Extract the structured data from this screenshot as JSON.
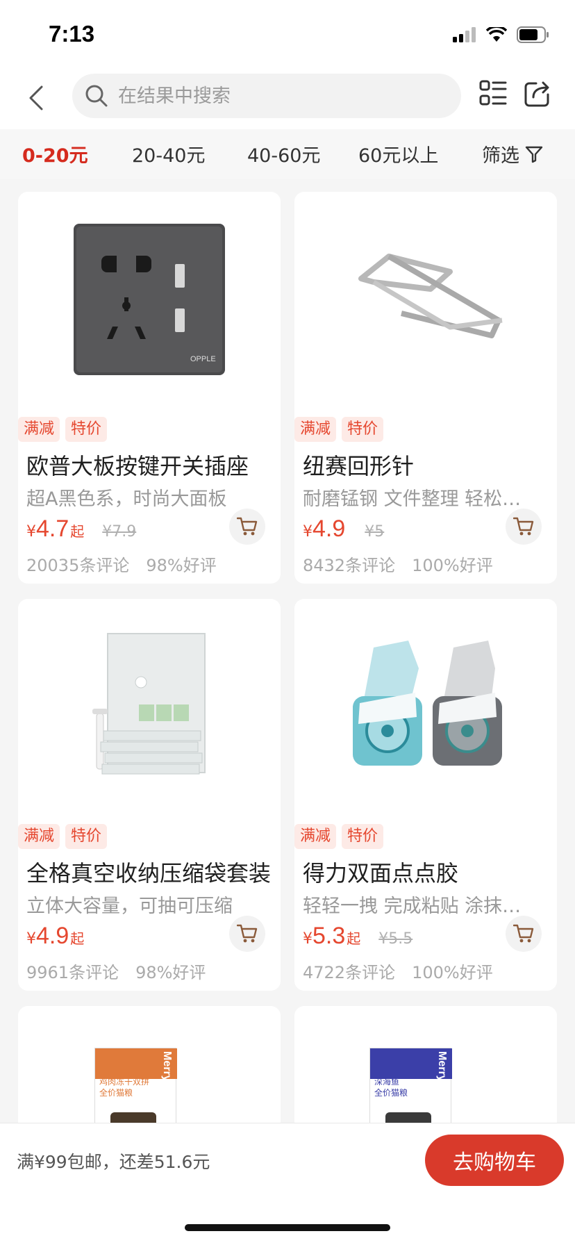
{
  "status": {
    "time": "7:13"
  },
  "search": {
    "placeholder": "在结果中搜索"
  },
  "filters": [
    {
      "label": "0-20元",
      "active": true
    },
    {
      "label": "20-40元"
    },
    {
      "label": "40-60元"
    },
    {
      "label": "60元以上"
    },
    {
      "label": "筛选"
    }
  ],
  "products": [
    {
      "tags": [
        "满减",
        "特价"
      ],
      "title": "欧普大板按键开关插座",
      "subtitle": "超A黑色系，时尚大面板",
      "currency": "¥",
      "price": "4.7",
      "price_suffix": "起",
      "orig_price": "¥7.9",
      "reviews": "20035条评论",
      "rating": "98%好评"
    },
    {
      "tags": [
        "满减",
        "特价"
      ],
      "title": "纽赛回形针",
      "subtitle": "耐磨锰钢 文件整理 轻松固定",
      "currency": "¥",
      "price": "4.9",
      "price_suffix": "",
      "orig_price": "¥5",
      "reviews": "8432条评论",
      "rating": "100%好评"
    },
    {
      "tags": [
        "满减",
        "特价"
      ],
      "title": "全格真空收纳压缩袋套装",
      "subtitle": "立体大容量，可抽可压缩",
      "currency": "¥",
      "price": "4.9",
      "price_suffix": "起",
      "orig_price": "",
      "reviews": "9961条评论",
      "rating": "98%好评"
    },
    {
      "tags": [
        "满减",
        "特价"
      ],
      "title": "得力双面点点胶",
      "subtitle": "轻轻一拽 完成粘贴 涂抹均匀",
      "currency": "¥",
      "price": "5.3",
      "price_suffix": "起",
      "orig_price": "¥5.5",
      "reviews": "4722条评论",
      "rating": "100%好评"
    },
    {
      "pack_brand": "Merry Pet",
      "pack_text": "鸡肉冻干双拼\n全价猫粮",
      "pack_color": "#e07a3a"
    },
    {
      "pack_brand": "Merry Pet",
      "pack_text": "深海鱼\n全价猫粮",
      "pack_color": "#3b3fa8"
    }
  ],
  "bottom": {
    "shipping": "满¥99包邮，还差51.6元",
    "go_cart": "去购物车"
  },
  "colors": {
    "accent": "#d52b1e",
    "price": "#e5472f",
    "cart_button": "#d93a2b"
  }
}
